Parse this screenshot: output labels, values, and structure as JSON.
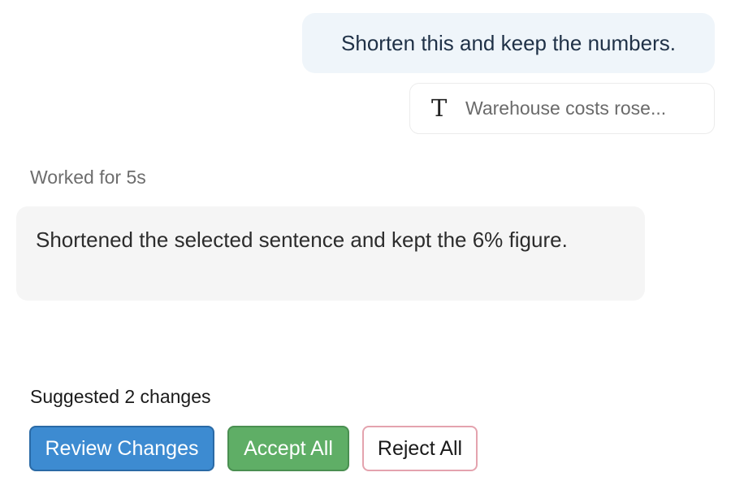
{
  "user_message": {
    "text": "Shorten this and keep the numbers."
  },
  "context_chip": {
    "icon": "text-icon",
    "icon_glyph": "T",
    "text": "Warehouse costs rose..."
  },
  "status": {
    "worked_label": "Worked for 5s"
  },
  "assistant_message": {
    "text": "Shortened the selected sentence and kept the 6% figure."
  },
  "suggestions": {
    "label": "Suggested 2 changes",
    "review_label": "Review Changes",
    "accept_label": "Accept All",
    "reject_label": "Reject All"
  },
  "colors": {
    "primary": "#3d8bd1",
    "success": "#5fae66",
    "danger_outline": "#e4a3ae",
    "user_bubble": "#eff5fa",
    "assistant_bubble": "#f5f5f5"
  }
}
